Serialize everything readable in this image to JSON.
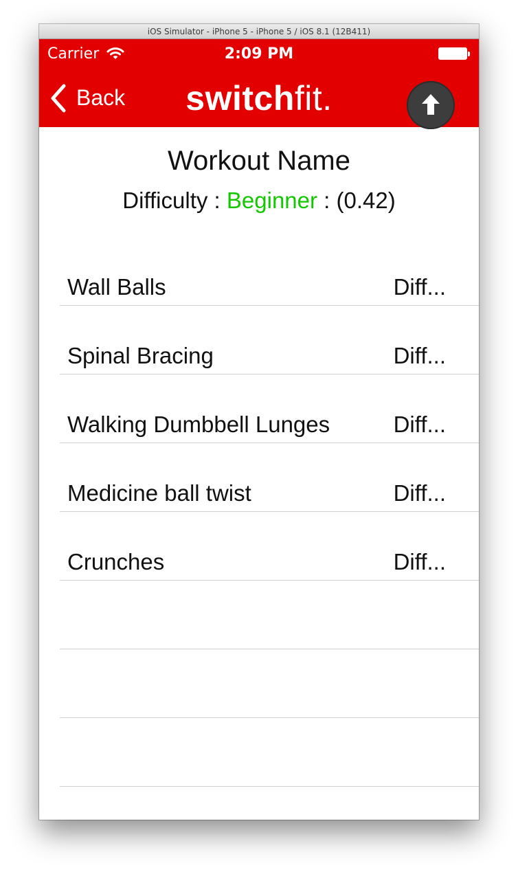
{
  "window": {
    "title": "iOS Simulator - iPhone 5 - iPhone 5 / iOS 8.1 (12B411)"
  },
  "status_bar": {
    "carrier": "Carrier",
    "time": "2:09 PM"
  },
  "nav": {
    "back_label": "Back",
    "brand_bold": "switch",
    "brand_light": "fit.",
    "accent_color": "#e30000"
  },
  "workout": {
    "name": "Workout Name",
    "difficulty_label": "Difficulty :",
    "difficulty_level": "Beginner",
    "difficulty_score": ": (0.42)",
    "level_color": "#13c800"
  },
  "exercises": [
    {
      "name": "Wall Balls",
      "difficulty": "Diff..."
    },
    {
      "name": "Spinal Bracing",
      "difficulty": "Diff..."
    },
    {
      "name": "Walking Dumbbell Lunges",
      "difficulty": "Diff..."
    },
    {
      "name": "Medicine ball twist",
      "difficulty": "Diff..."
    },
    {
      "name": "Crunches",
      "difficulty": "Diff..."
    },
    {
      "name": "",
      "difficulty": ""
    },
    {
      "name": "",
      "difficulty": ""
    },
    {
      "name": "",
      "difficulty": ""
    }
  ],
  "icons": {
    "wifi": "wifi-icon",
    "battery": "battery-icon",
    "back": "chevron-left-icon",
    "upload": "arrow-up-icon"
  }
}
